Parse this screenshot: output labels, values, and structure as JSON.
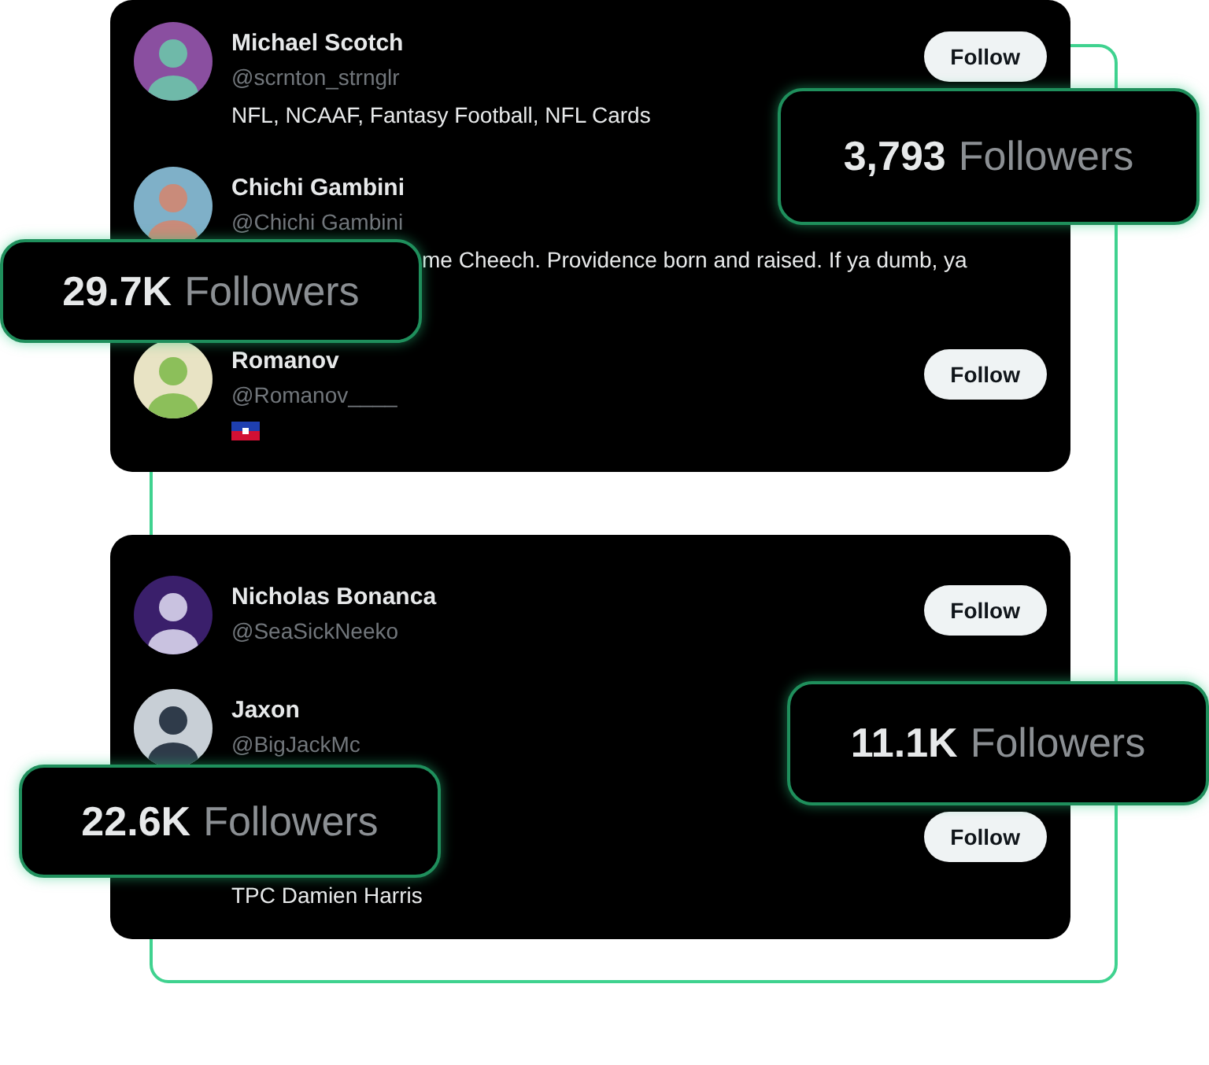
{
  "cards": [
    {
      "users": [
        {
          "name": "Michael Scotch",
          "handle": "@scrnton_strnglr",
          "bio": "NFL, NCAAF, Fantasy Football, NFL Cards",
          "follow": "Follow"
        },
        {
          "name": "Chichi Gambini",
          "handle": "@Chichi Gambini",
          "bio": "me Cheech. Providence born and raised. If ya dumb, ya"
        },
        {
          "name": "Romanov",
          "handle": "@Romanov____",
          "flag": true,
          "follow": "Follow"
        }
      ]
    },
    {
      "users": [
        {
          "name": "Nicholas Bonanca",
          "handle": "@SeaSickNeeko",
          "follow": "Follow"
        },
        {
          "name": "Jaxon",
          "handle": "@BigJackMc"
        },
        {
          "bio": "TPC Damien Harris",
          "follow": "Follow"
        }
      ]
    }
  ],
  "badges": [
    {
      "count": "3,793",
      "label": "Followers"
    },
    {
      "count": "29.7K",
      "label": "Followers"
    },
    {
      "count": "11.1K",
      "label": "Followers"
    },
    {
      "count": "22.6K",
      "label": "Followers"
    }
  ]
}
